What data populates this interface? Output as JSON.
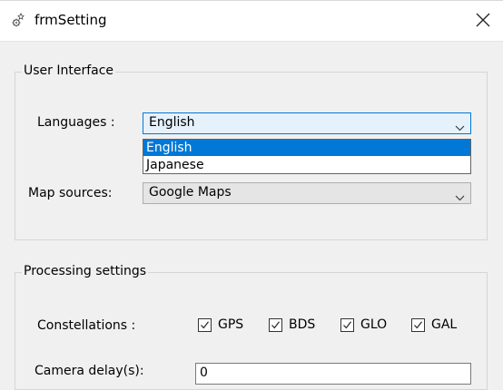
{
  "window": {
    "title": "frmSetting",
    "icon": "gear-sparkle-icon",
    "close": "close-icon"
  },
  "user_interface": {
    "title": "User Interface",
    "languages_label": "Languages :",
    "languages_value": "English",
    "language_options": [
      "English",
      "Japanese"
    ],
    "map_sources_label": "Map sources:",
    "map_sources_value": "Google Maps"
  },
  "processing": {
    "title": "Processing settings",
    "constellations_label": "Constellations :",
    "constellations": [
      {
        "label": "GPS",
        "checked": true
      },
      {
        "label": "BDS",
        "checked": true
      },
      {
        "label": "GLO",
        "checked": true
      },
      {
        "label": "GAL",
        "checked": true
      }
    ],
    "camera_delay_label": "Camera delay(s):",
    "camera_delay_value": "0"
  },
  "colors": {
    "accent": "#0078d7",
    "background": "#f0f0f0"
  }
}
